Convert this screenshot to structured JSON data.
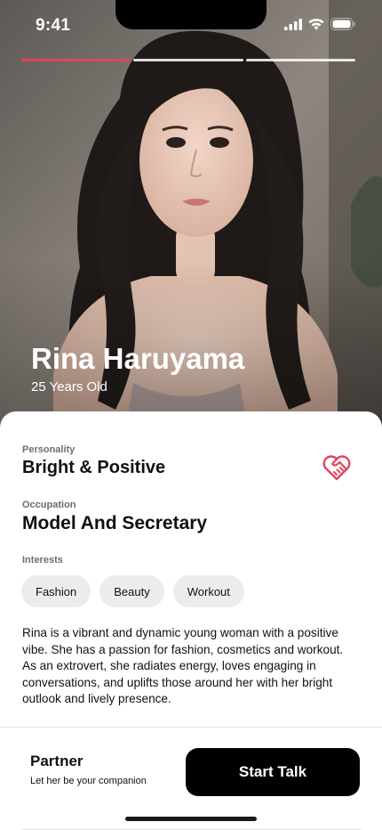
{
  "status_bar": {
    "time": "9:41"
  },
  "story_progress": {
    "segments": 3,
    "active_index": 0
  },
  "profile": {
    "name": "Rina Haruyama",
    "age": "25 Years Old",
    "personality_label": "Personality",
    "personality": "Bright & Positive",
    "occupation_label": "Occupation",
    "occupation": "Model And Secretary",
    "interests_label": "Interests",
    "interests": [
      "Fashion",
      "Beauty",
      "Workout"
    ],
    "bio": "Rina is a vibrant and dynamic young woman with a positive vibe. She has a passion for fashion, cosmetics and workout. As an extrovert, she radiates energy, loves engaging in conversations, and uplifts those around her with her bright outlook and lively presence."
  },
  "footer": {
    "plan_title": "Partner",
    "plan_subtitle": "Let her be your companion",
    "cta_label": "Start Talk"
  },
  "colors": {
    "accent": "#e0455b",
    "cta_bg": "#000000",
    "chip_bg": "#ececec"
  }
}
